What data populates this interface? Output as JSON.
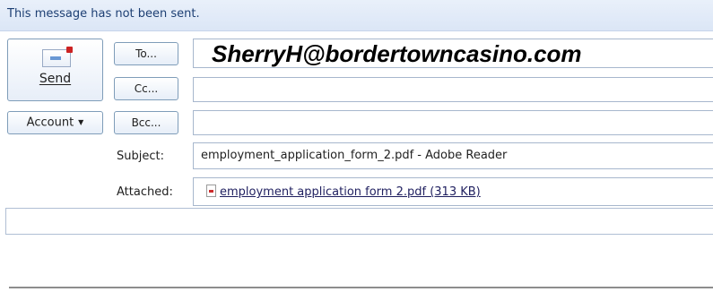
{
  "infobar": {
    "text": "This message has not been sent."
  },
  "buttons": {
    "send_label": "Send",
    "account_label": "Account",
    "to_label": "To...",
    "cc_label": "Cc...",
    "bcc_label": "Bcc..."
  },
  "fields": {
    "to_value": "SherryH@bordertowncasino.com",
    "cc_value": "",
    "bcc_value": "",
    "subject_label": "Subject:",
    "subject_value": "employment_application_form_2.pdf - Adobe Reader",
    "attached_label": "Attached:",
    "attachment_name": "employment application form 2.pdf (313 KB)"
  },
  "icons": {
    "send": "send-icon",
    "account_dropdown": "chevron-down-icon",
    "attachment": "pdf-file-icon"
  },
  "colors": {
    "infobar_bg": "#dbe6f6",
    "infobar_text": "#1d3f73",
    "button_border": "#7f9db9",
    "field_border": "#a7b7cd"
  }
}
